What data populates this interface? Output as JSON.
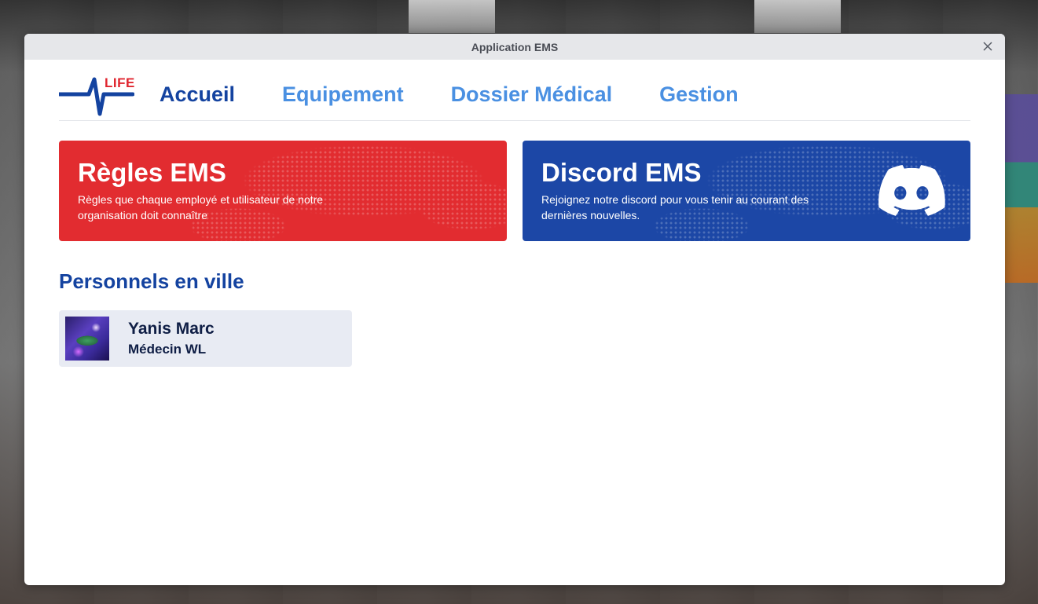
{
  "window": {
    "title": "Application EMS"
  },
  "logo": {
    "text": "LIFE"
  },
  "nav": {
    "tabs": [
      {
        "label": "Accueil",
        "active": true
      },
      {
        "label": "Equipement",
        "active": false
      },
      {
        "label": "Dossier Médical",
        "active": false
      },
      {
        "label": "Gestion",
        "active": false
      }
    ]
  },
  "cards": {
    "rules": {
      "title": "Règles EMS",
      "description": "Règles que chaque employé et utilisateur de notre organisation doit connaître"
    },
    "discord": {
      "title": "Discord EMS",
      "description": "Rejoignez notre discord pour vous tenir au courant des dernières nouvelles.",
      "icon": "discord-icon"
    }
  },
  "personnel": {
    "heading": "Personnels en ville",
    "members": [
      {
        "name": "Yanis Marc",
        "role": "Médecin WL"
      }
    ]
  },
  "colors": {
    "accent_dark": "#1443a0",
    "accent_light": "#4a90e2",
    "rules_card": "#e22c30",
    "discord_card": "#1c47a6",
    "logo_red": "#e0262f"
  }
}
